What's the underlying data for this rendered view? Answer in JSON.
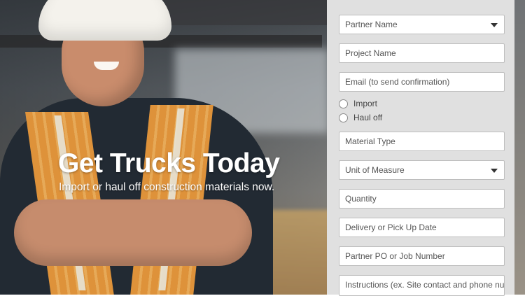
{
  "hero": {
    "headline": "Get Trucks Today",
    "subline": "Import or haul off construction materials now."
  },
  "form": {
    "partner_name": "Partner Name",
    "project_name": "Project Name",
    "email": "Email (to send confirmation)",
    "radio_import": "Import",
    "radio_haul_off": "Haul off",
    "material_type": "Material Type",
    "unit_of_measure": "Unit of Measure",
    "quantity": "Quantity",
    "delivery_date": "Delivery or Pick Up Date",
    "po_number": "Partner PO or Job Number",
    "instructions": "Instructions (ex. Site contact and phone number)"
  },
  "colors": {
    "panel_bg": "#e0e0e0",
    "field_border": "#bdbdbd",
    "hero_text": "#ffffff"
  }
}
